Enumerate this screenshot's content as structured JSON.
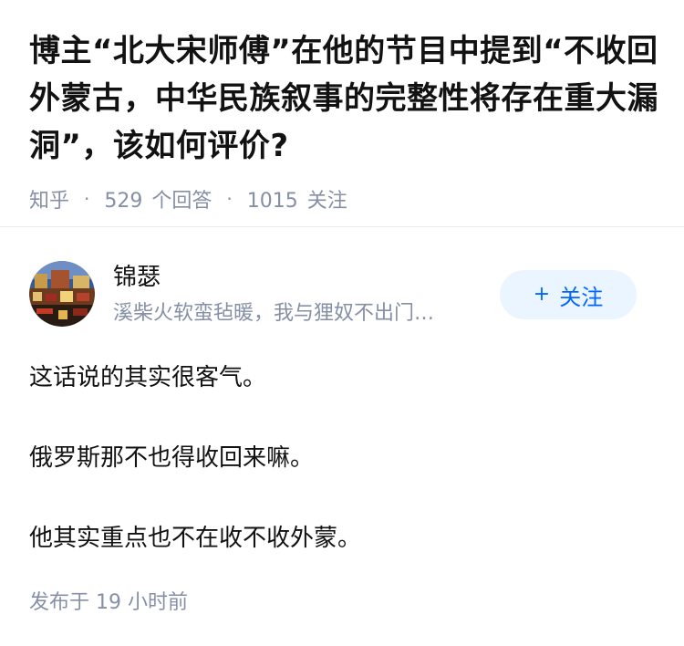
{
  "question": {
    "title": "博主“北大宋师傅”在他的节目中提到“不收回外蒙古，中华民族叙事的完整性将存在重大漏洞”，该如何评价?",
    "source": "知乎",
    "answer_count": "529",
    "answer_label": "个回答",
    "follower_count": "1015",
    "follower_label": "关注",
    "separator": "·"
  },
  "author": {
    "name": "锦瑟",
    "bio": "溪柴火软蛮毡暖，我与狸奴不出门…",
    "follow_label": "关注",
    "follow_icon": "+"
  },
  "answer": {
    "paragraphs": [
      "这话说的其实很客气。",
      "俄罗斯那不也得收回来嘛。",
      "他其实重点也不在收不收外蒙。"
    ],
    "published_label": "发布于",
    "published_time": "19 小时前"
  },
  "colors": {
    "text_primary": "#121212",
    "text_secondary": "#8590a6",
    "brand_blue": "#0066ff",
    "follow_bg": "#ebf5ff"
  }
}
